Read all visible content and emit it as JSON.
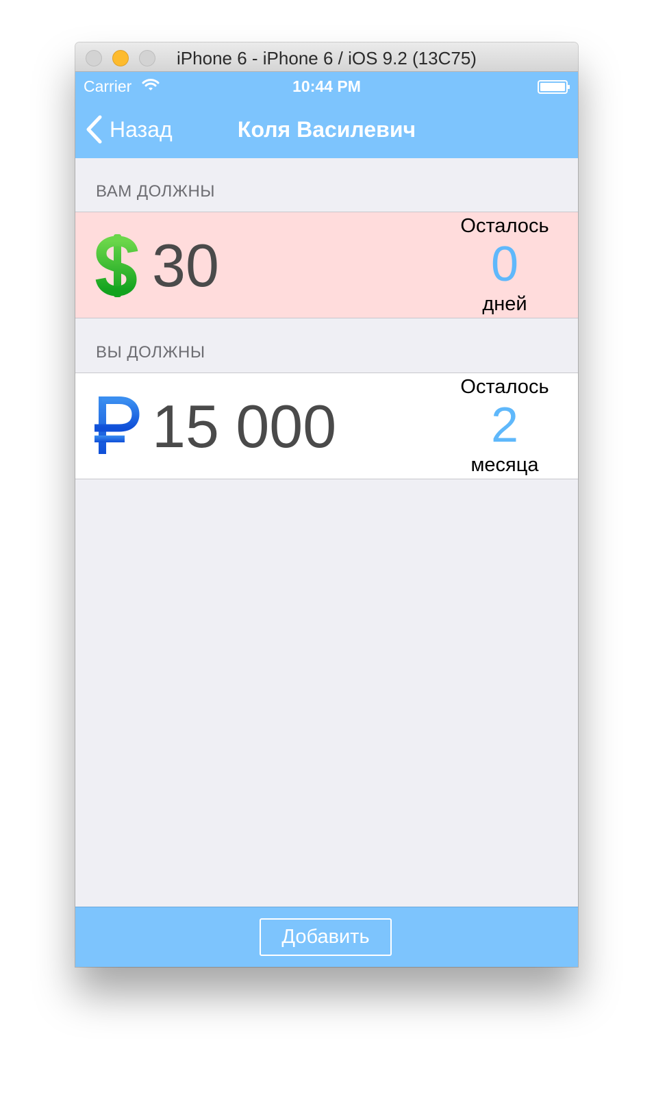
{
  "window": {
    "title": "iPhone 6 - iPhone 6 / iOS 9.2 (13C75)"
  },
  "status_bar": {
    "carrier": "Carrier",
    "time": "10:44 PM"
  },
  "nav": {
    "back_label": "Назад",
    "title": "Коля Василевич"
  },
  "sections": [
    {
      "header": "ВАМ ДОЛЖНЫ",
      "currency_icon": "dollar-sign-icon",
      "amount": "30",
      "remaining_label": "Осталось",
      "remaining_value": "0",
      "remaining_unit": "дней"
    },
    {
      "header": "ВЫ ДОЛЖНЫ",
      "currency_icon": "ruble-sign-icon",
      "amount": "15 000",
      "remaining_label": "Осталось",
      "remaining_value": "2",
      "remaining_unit": "месяца"
    }
  ],
  "toolbar": {
    "add_label": "Добавить"
  },
  "colors": {
    "nav_background": "#7dc4fd",
    "owed_to_you_background": "#ffdcdc",
    "accent_number": "#5fb8fb",
    "list_background": "#efeff4"
  }
}
